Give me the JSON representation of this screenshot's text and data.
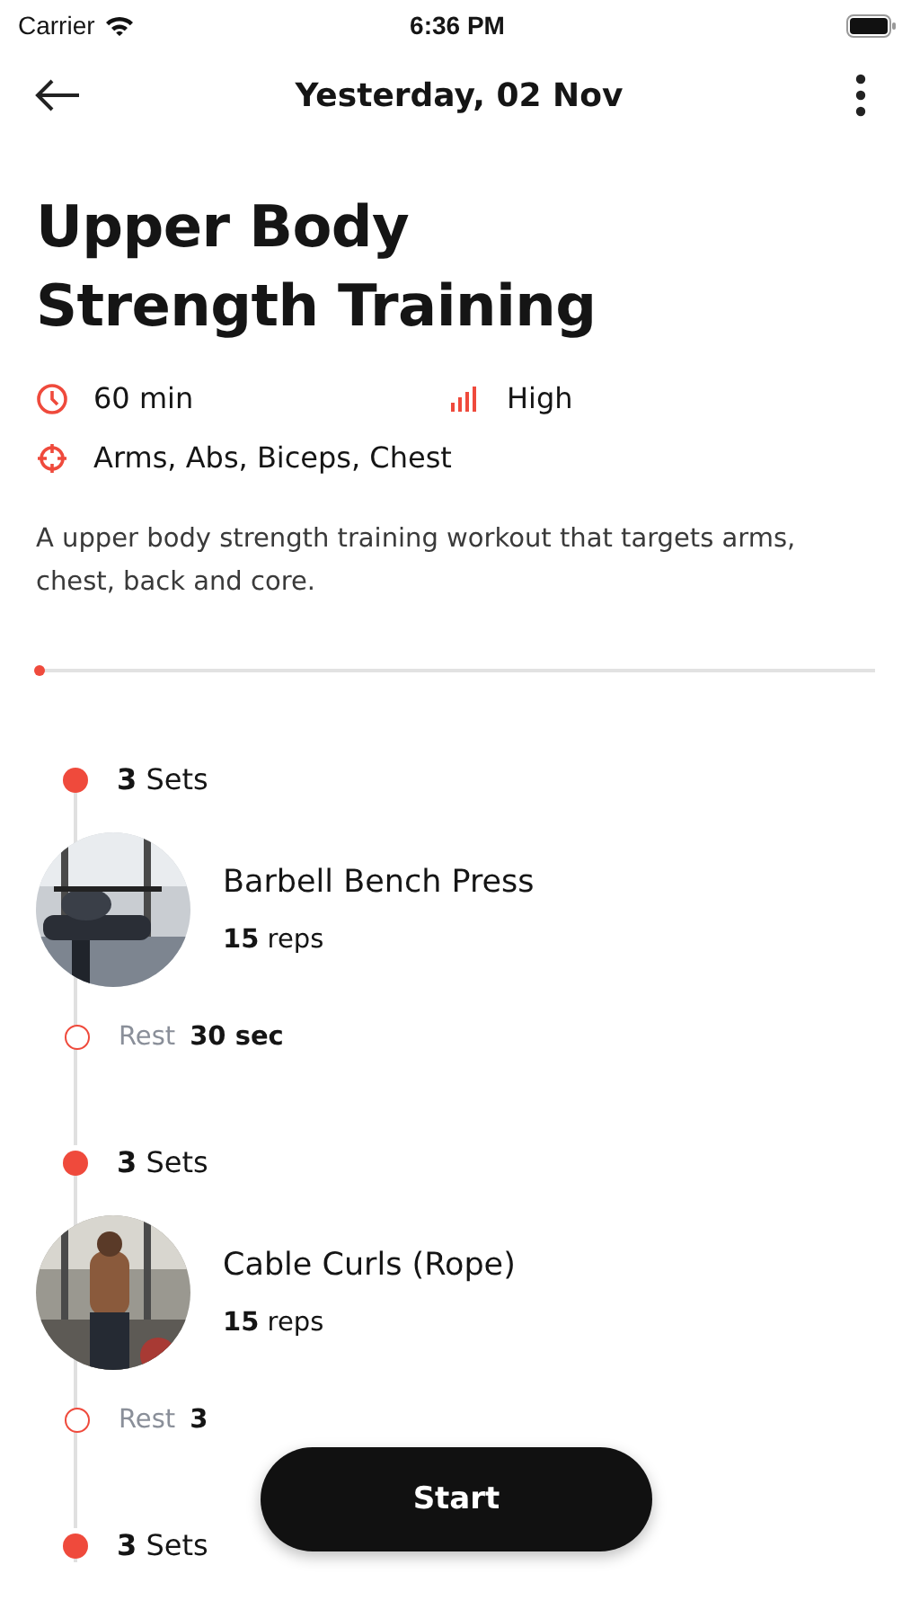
{
  "status_bar": {
    "carrier": "Carrier",
    "time": "6:36 PM"
  },
  "header": {
    "title": "Yesterday, 02 Nov"
  },
  "workout": {
    "title": "Upper Body Strength Training",
    "duration": "60 min",
    "intensity": "High",
    "muscles": "Arms, Abs, Biceps, Chest",
    "description": "A upper body strength training workout that targets arms, chest, back and core."
  },
  "progress": {
    "level": 0
  },
  "blocks": [
    {
      "sets": "**3** Sets",
      "exercise": "Barbell Bench Press",
      "reps": "**15** reps",
      "rest_label": "Rest",
      "rest_value": "30 sec"
    },
    {
      "sets": "**3** Sets",
      "exercise": "Cable Curls (Rope)",
      "reps": "**15** reps",
      "rest_label": "Rest",
      "rest_value": "3"
    },
    {
      "sets": "**3** Sets"
    }
  ],
  "start_button": {
    "label": "Start"
  }
}
